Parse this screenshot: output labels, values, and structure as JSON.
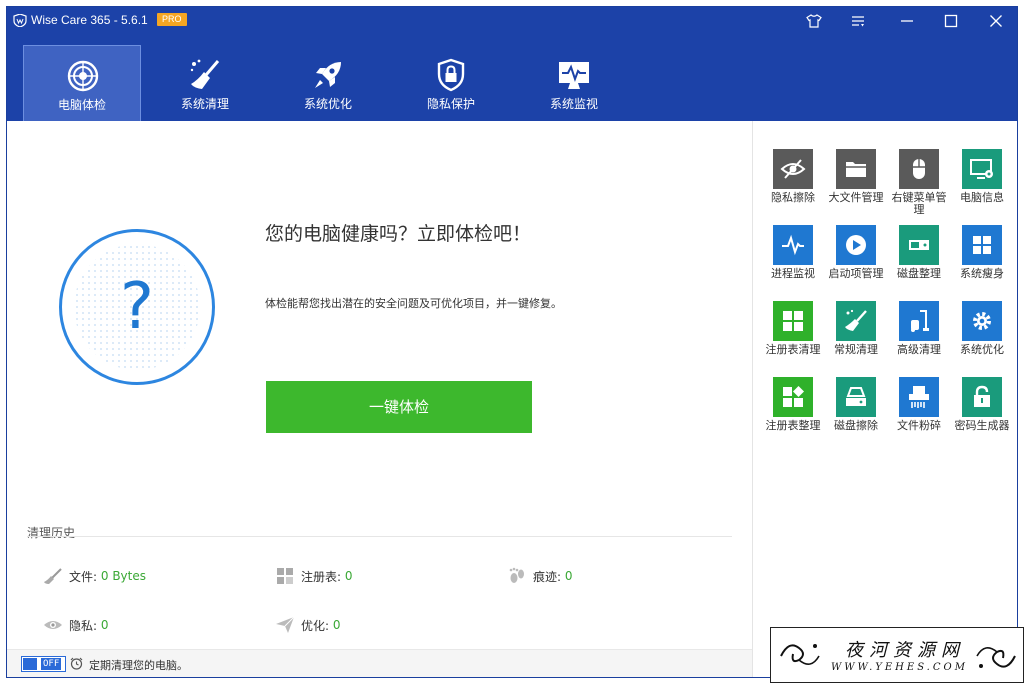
{
  "window": {
    "title": "Wise Care 365 - 5.6.1",
    "badge": "PRO",
    "controls": [
      "tshirt-icon",
      "menu-icon",
      "minimize-icon",
      "maximize-icon",
      "close-icon"
    ]
  },
  "nav": {
    "tabs": [
      {
        "label": "电脑体检",
        "icon": "radar-icon",
        "active": true
      },
      {
        "label": "系统清理",
        "icon": "broom-icon",
        "active": false
      },
      {
        "label": "系统优化",
        "icon": "rocket-icon",
        "active": false
      },
      {
        "label": "隐私保护",
        "icon": "shield-lock-icon",
        "active": false
      },
      {
        "label": "系统监视",
        "icon": "monitor-pulse-icon",
        "active": false
      }
    ]
  },
  "health": {
    "title": "您的电脑健康吗？立即体检吧！",
    "description": "体检能帮您找出潜在的安全问题及可优化项目，并一键修复。",
    "button": "一键体检",
    "status_symbol": "?"
  },
  "history": {
    "title": "清理历史",
    "items": [
      {
        "label": "文件:",
        "value": "0 Bytes",
        "icon": "brush-icon"
      },
      {
        "label": "注册表:",
        "value": "0",
        "icon": "registry-icon"
      },
      {
        "label": "痕迹:",
        "value": "0",
        "icon": "footprints-icon"
      },
      {
        "label": "隐私:",
        "value": "0",
        "icon": "eye-icon"
      },
      {
        "label": "优化:",
        "value": "0",
        "icon": "paper-plane-icon"
      }
    ]
  },
  "footer": {
    "toggle_text": "OFF",
    "text": "定期清理您的电脑。"
  },
  "tools": [
    {
      "label": "隐私擦除",
      "color": "#5a5a5a",
      "icon": "eye-slash-icon"
    },
    {
      "label": "大文件管理",
      "color": "#5a5a5a",
      "icon": "folder-icon"
    },
    {
      "label": "右键菜单管理",
      "color": "#5a5a5a",
      "icon": "mouse-icon"
    },
    {
      "label": "电脑信息",
      "color": "#1a9b7c",
      "icon": "pc-info-icon"
    },
    {
      "label": "进程监视",
      "color": "#1f78d1",
      "icon": "pulse-icon"
    },
    {
      "label": "启动项管理",
      "color": "#1f78d1",
      "icon": "play-icon"
    },
    {
      "label": "磁盘整理",
      "color": "#1a9b7c",
      "icon": "disk-icon"
    },
    {
      "label": "系统瘦身",
      "color": "#1f78d1",
      "icon": "windows-icon"
    },
    {
      "label": "注册表清理",
      "color": "#2fb12a",
      "icon": "registry-grid-icon"
    },
    {
      "label": "常规清理",
      "color": "#1a9b7c",
      "icon": "broom-icon"
    },
    {
      "label": "高级清理",
      "color": "#1f78d1",
      "icon": "vacuum-icon"
    },
    {
      "label": "系统优化",
      "color": "#1f78d1",
      "icon": "gear-icon"
    },
    {
      "label": "注册表整理",
      "color": "#2fb12a",
      "icon": "registry-defrag-icon"
    },
    {
      "label": "磁盘擦除",
      "color": "#1a9b7c",
      "icon": "disk-erase-icon"
    },
    {
      "label": "文件粉碎",
      "color": "#1f78d1",
      "icon": "shredder-icon"
    },
    {
      "label": "密码生成器",
      "color": "#1a9b7c",
      "icon": "padlock-icon"
    }
  ],
  "watermark": {
    "text": "夜河资源网",
    "url": "WWW.YEHES.COM"
  }
}
